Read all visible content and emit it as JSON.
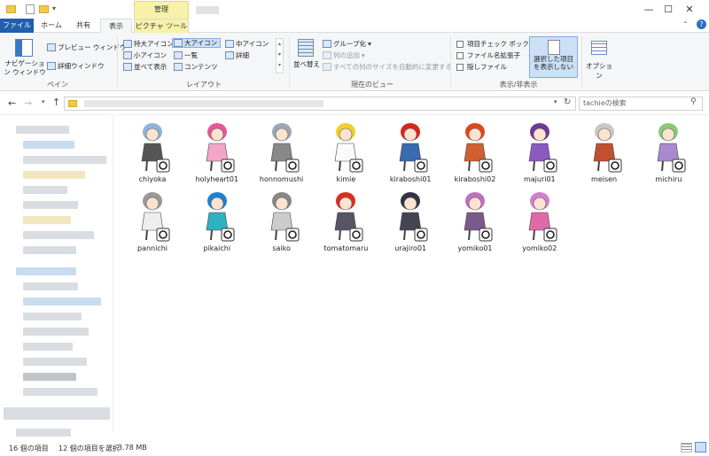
{
  "titlebar": {
    "context_tab": "管理",
    "minimize": "—",
    "maximize": "☐",
    "close": "✕"
  },
  "tabs": [
    {
      "label": "ファイル"
    },
    {
      "label": "ホーム"
    },
    {
      "label": "共有"
    },
    {
      "label": "表示"
    },
    {
      "label": "ピクチャ ツール"
    }
  ],
  "ribbon": {
    "pane": {
      "nav_pane": "ナビゲーション ウィンドウ",
      "preview_pane": "プレビュー ウィンドウ",
      "details_pane": "詳細ウィンドウ",
      "label": "ペイン"
    },
    "layout": {
      "items": [
        "特大アイコン",
        "大アイコン",
        "中アイコン",
        "小アイコン",
        "一覧",
        "詳細",
        "並べて表示",
        "コンテンツ"
      ],
      "label": "レイアウト"
    },
    "current_view": {
      "sort": "並べ替え",
      "group": "グループ化",
      "add_col": "列の追加",
      "fit_cols": "すべての列のサイズを自動的に変更する",
      "label": "現在のビュー"
    },
    "show_hide": {
      "checkboxes": "項目チェック ボックス",
      "extensions": "ファイル名拡張子",
      "hidden": "隠しファイル",
      "hide_selected": "選択した項目を表示しない",
      "label": "表示/非表示"
    },
    "options": "オプション"
  },
  "search": {
    "placeholder": "tachieの検索"
  },
  "files": [
    {
      "name": "chiyoka",
      "hair": "#8fb4d8",
      "body": "#555"
    },
    {
      "name": "holyheart01",
      "hair": "#e8559a",
      "body": "#f3a6c8"
    },
    {
      "name": "honnomushi",
      "hair": "#9aa7b5",
      "body": "#888"
    },
    {
      "name": "kimie",
      "hair": "#f0d030",
      "body": "#fafafa"
    },
    {
      "name": "kiraboshi01",
      "hair": "#d8261d",
      "body": "#3a6ab0"
    },
    {
      "name": "kiraboshi02",
      "hair": "#e2451c",
      "body": "#d06030"
    },
    {
      "name": "majuri01",
      "hair": "#6b3a9a",
      "body": "#8a5ac0"
    },
    {
      "name": "meisen",
      "hair": "#c8c8c8",
      "body": "#c05030"
    },
    {
      "name": "michiru",
      "hair": "#8ac878",
      "body": "#a98ad0"
    },
    {
      "name": "pannichi",
      "hair": "#999",
      "body": "#eee"
    },
    {
      "name": "pikaichi",
      "hair": "#2080d0",
      "body": "#30b0c0"
    },
    {
      "name": "saiko",
      "hair": "#888",
      "body": "#ccc"
    },
    {
      "name": "tomatomaru",
      "hair": "#d83020",
      "body": "#556"
    },
    {
      "name": "urajiro01",
      "hair": "#334",
      "body": "#445"
    },
    {
      "name": "yomiko01",
      "hair": "#c070c0",
      "body": "#7a5a8a"
    },
    {
      "name": "yomiko02",
      "hair": "#d080d0",
      "body": "#e06aa8"
    }
  ],
  "status": {
    "count": "16 個の項目",
    "selected": "12 個の項目を選択",
    "size": "3.78 MB"
  }
}
